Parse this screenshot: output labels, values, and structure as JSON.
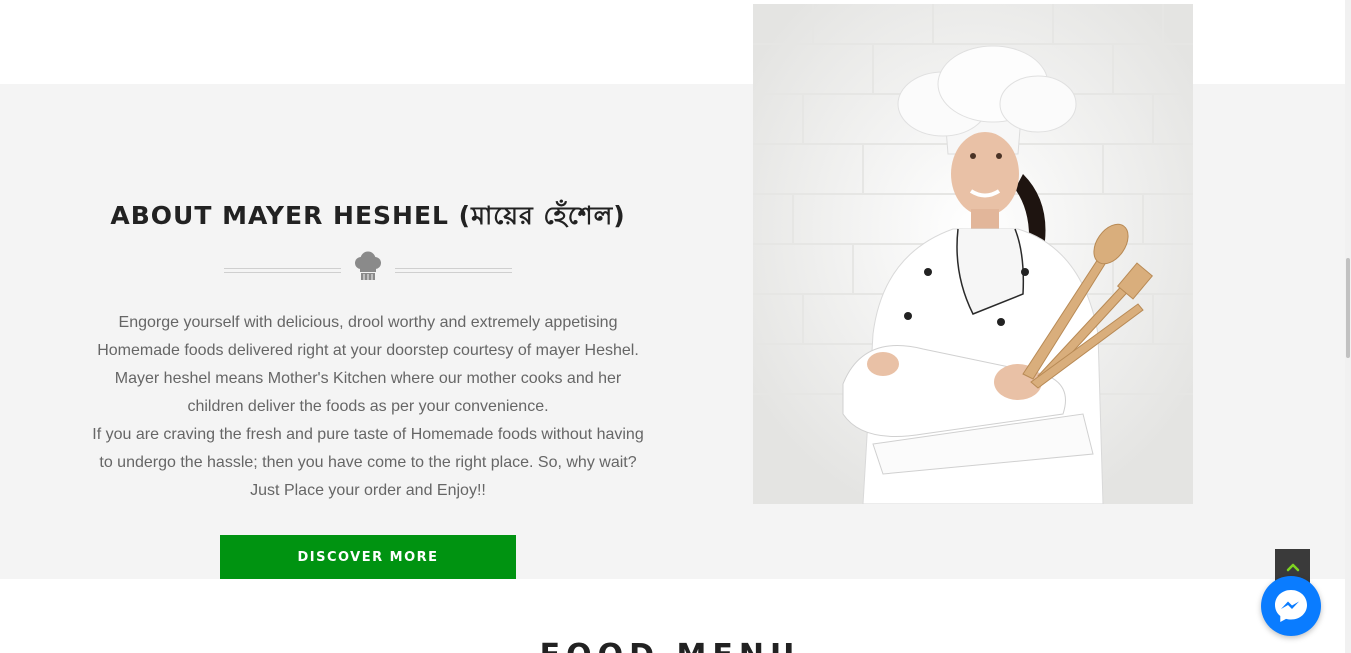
{
  "about": {
    "title": "ABOUT MAYER HESHEL (মায়ের হেঁশেল)",
    "paragraph_1": "Engorge yourself with delicious, drool worthy and extremely appetising Homemade foods delivered right at your doorstep courtesy of mayer Heshel. Mayer heshel means Mother's Kitchen where our mother cooks and her children deliver the foods as per your convenience.",
    "paragraph_2": "If you are craving the fresh and pure taste of Homemade foods without having to undergo the hassle; then you have come to the right place. So, why wait? Just Place your order and Enjoy!!",
    "button_label": "DISCOVER MORE",
    "divider_icon": "chef-hat-icon",
    "photo": "chef-woman-photo"
  },
  "next_section": {
    "title": "FOOD MENU"
  },
  "floating": {
    "back_to_top_icon": "chevron-up-icon",
    "messenger_icon": "messenger-icon"
  },
  "colors": {
    "accent_green": "#009311",
    "band_background": "#f4f4f4",
    "messenger_blue": "#0a7cff",
    "chevron_green": "#7ed321"
  }
}
